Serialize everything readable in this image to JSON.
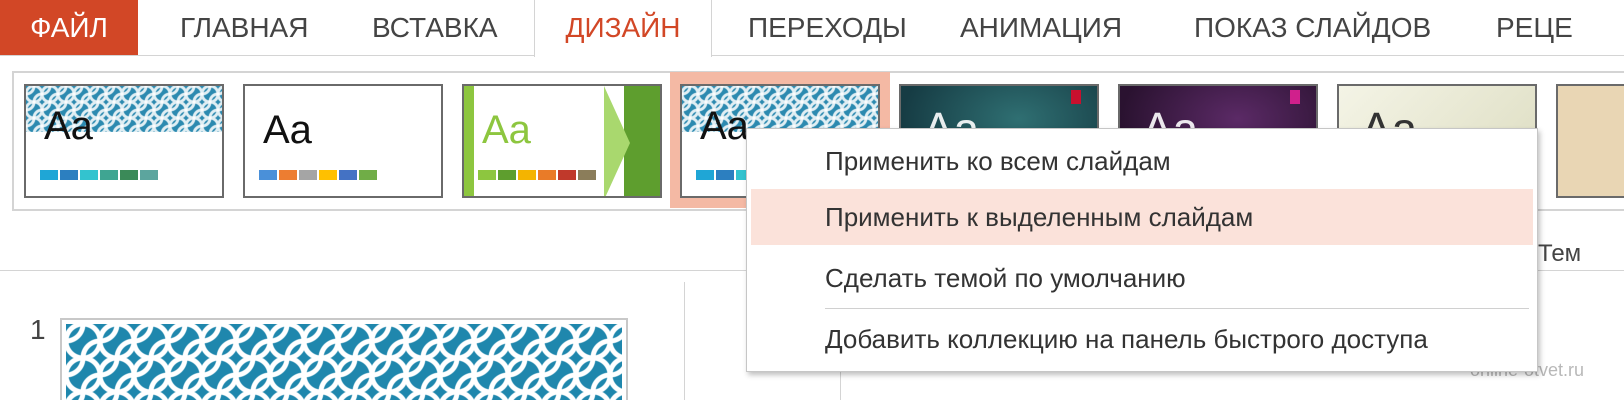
{
  "ribbon": {
    "tabs": [
      {
        "label": "ФАЙЛ"
      },
      {
        "label": "ГЛАВНАЯ"
      },
      {
        "label": "ВСТАВКА"
      },
      {
        "label": "ДИЗАЙН"
      },
      {
        "label": "ПЕРЕХОДЫ"
      },
      {
        "label": "АНИМАЦИЯ"
      },
      {
        "label": "ПОКАЗ СЛАЙДОВ"
      },
      {
        "label": "РЕЦЕ"
      }
    ],
    "active_tab": "ДИЗАЙН"
  },
  "themes": {
    "items": [
      {
        "preview_text": "Aa",
        "swatches": [
          "#1fa6d6",
          "#2c7fc0",
          "#33c3cf",
          "#3fa592",
          "#3b8a58",
          "#5ca59e"
        ]
      },
      {
        "preview_text": "Aa",
        "swatches": [
          "#4a90d9",
          "#ed7d31",
          "#a5a5a5",
          "#ffc000",
          "#4472c4",
          "#70ad47"
        ]
      },
      {
        "preview_text": "Aa",
        "swatches": [
          "#8dc63f",
          "#5e9e2e",
          "#f4b400",
          "#e97b28",
          "#c0392b",
          "#8b7d5a"
        ]
      },
      {
        "preview_text": "Aa",
        "swatches": [
          "#1fa6d6",
          "#2c7fc0",
          "#33c3cf"
        ]
      },
      {
        "preview_text": "Aa"
      },
      {
        "preview_text": "Aa"
      },
      {
        "preview_text": "Aa"
      }
    ],
    "selected_index": 3
  },
  "group_label_partial": "Тем",
  "context_menu": {
    "items": [
      {
        "label": "Применить ко всем слайдам"
      },
      {
        "label": "Применить к выделенным слайдам",
        "highlighted": true
      },
      {
        "label": "Сделать темой по умолчанию"
      },
      {
        "label": "Добавить коллекцию на панель быстрого доступа"
      }
    ]
  },
  "slides_panel": {
    "slide_number": "1"
  },
  "watermark": "online-otvet.ru",
  "colors": {
    "accent": "#d24726",
    "menu_highlight": "#fbe2da",
    "selection": "#f4b9a4",
    "theme_blue": "#2c8ab0"
  }
}
